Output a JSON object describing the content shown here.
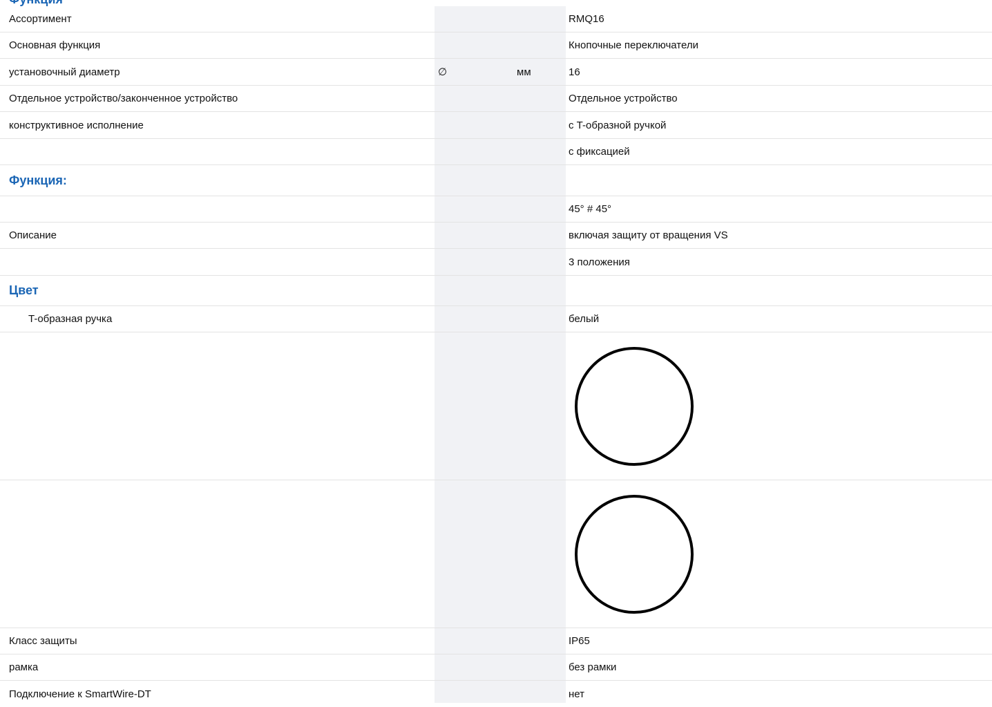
{
  "top_heading": "Функция",
  "rows": [
    {
      "label": "Ассортимент",
      "symbol": "",
      "unit": "",
      "value": "RMQ16"
    },
    {
      "label": "Основная функция",
      "symbol": "",
      "unit": "",
      "value": "Кнопочные переключатели"
    },
    {
      "label": "установочный диаметр",
      "symbol": "∅",
      "unit": "мм",
      "value": "16"
    },
    {
      "label": "Отдельное устройство/законченное устройство",
      "symbol": "",
      "unit": "",
      "value": "Отдельное устройство"
    },
    {
      "label": "конструктивное исполнение",
      "symbol": "",
      "unit": "",
      "value": "с T-образной ручкой"
    },
    {
      "label": "",
      "symbol": "",
      "unit": "",
      "value": "с фиксацией"
    },
    {
      "label": "Функция:",
      "symbol": "",
      "unit": "",
      "value": ""
    },
    {
      "label": "",
      "symbol": "",
      "unit": "",
      "value": "45° # 45°"
    },
    {
      "label": "Описание",
      "symbol": "",
      "unit": "",
      "value": "включая защиту от вращения VS"
    },
    {
      "label": "",
      "symbol": "",
      "unit": "",
      "value": "3 положения"
    },
    {
      "label": "Цвет",
      "symbol": "",
      "unit": "",
      "value": ""
    },
    {
      "label": "T-образная ручка",
      "symbol": "",
      "unit": "",
      "value": "белый"
    },
    {
      "label": "",
      "symbol": "",
      "unit": "",
      "value": ""
    },
    {
      "label": "",
      "symbol": "",
      "unit": "",
      "value": ""
    },
    {
      "label": "Класс защиты",
      "symbol": "",
      "unit": "",
      "value": "IP65"
    },
    {
      "label": "рамка",
      "symbol": "",
      "unit": "",
      "value": "без рамки"
    },
    {
      "label": "Подключение к SmartWire-DT",
      "symbol": "",
      "unit": "",
      "value": "нет"
    }
  ]
}
